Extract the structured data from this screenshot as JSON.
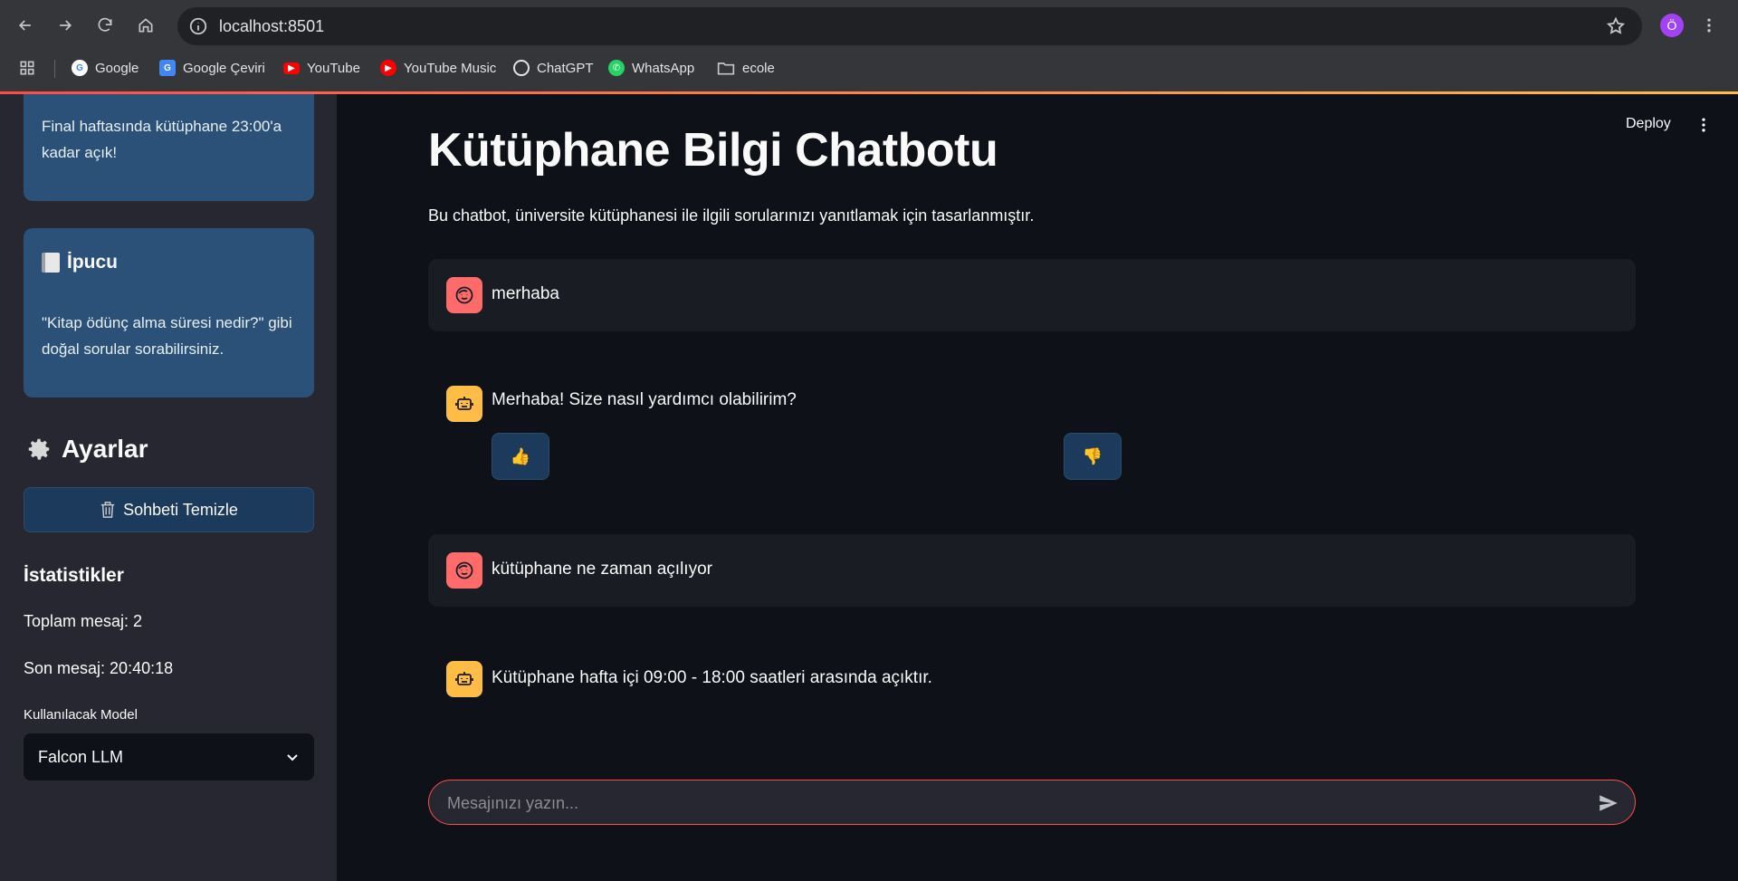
{
  "browser": {
    "url": "localhost:8501",
    "profile_initial": "Ö",
    "bookmarks": [
      {
        "label": "Google",
        "icon": "google-icon"
      },
      {
        "label": "Google Çeviri",
        "icon": "google-translate-icon"
      },
      {
        "label": "YouTube",
        "icon": "youtube-icon"
      },
      {
        "label": "YouTube Music",
        "icon": "youtube-music-icon"
      },
      {
        "label": "ChatGPT",
        "icon": "chatgpt-icon"
      },
      {
        "label": "WhatsApp",
        "icon": "whatsapp-icon"
      },
      {
        "label": "ecole",
        "icon": "folder-icon"
      }
    ]
  },
  "sidebar": {
    "notice_text": "Final haftasında kütüphane 23:00'a kadar açık!",
    "tip": {
      "icon": "book-icon",
      "title": "İpucu",
      "text": "\"Kitap ödünç alma süresi nedir?\" gibi doğal sorular sorabilirsiniz."
    },
    "settings_title": "Ayarlar",
    "clear_button": "Sohbeti Temizle",
    "stats_title": "İstatistikler",
    "total_messages": "Toplam mesaj: 2",
    "last_message": "Son mesaj: 20:40:18",
    "model_label": "Kullanılacak Model",
    "model_selected": "Falcon LLM"
  },
  "header": {
    "deploy": "Deploy"
  },
  "main": {
    "title": "Kütüphane Bilgi Chatbotu",
    "subtitle": "Bu chatbot, üniversite kütüphanesi ile ilgili sorularınızı yanıtlamak için tasarlanmıştır.",
    "messages": [
      {
        "role": "user",
        "text": "merhaba"
      },
      {
        "role": "assistant",
        "text": "Merhaba! Size nasıl yardımcı olabilirim?"
      },
      {
        "role": "user",
        "text": "kütüphane ne zaman açılıyor"
      },
      {
        "role": "assistant",
        "text": "Kütüphane hafta içi 09:00 - 18:00 saatleri arasında açıktır."
      }
    ],
    "feedback": {
      "up": "👍",
      "down": "👎"
    },
    "input_placeholder": "Mesajınızı yazın..."
  },
  "colors": {
    "background": "#0e1117",
    "sidebar": "#262730",
    "card": "#2c5178",
    "accent": "#ff4b4b",
    "user_avatar": "#ff6b6b",
    "bot_avatar": "#ffbd45"
  }
}
